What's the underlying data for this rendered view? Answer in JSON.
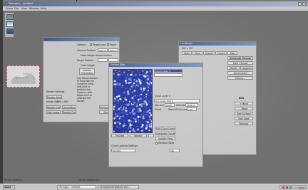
{
  "app": {
    "title": "Terragen – untitled"
  },
  "menu": [
    "Scene",
    "File",
    "View",
    "Window",
    "Help"
  ],
  "camera_panel": {
    "camera_label": "Camera",
    "target_lock": "Target Lock",
    "move": "Move",
    "camera_position": "Camera Position",
    "camera_position_values": [
      "500 m",
      "200 m"
    ],
    "fixed_height": "Fixed Height Above Surface",
    "target_position": "Target Position",
    "fixed_height_short": "Fixed Height",
    "camera_orientation": "Camera Orientation",
    "hint": "Use Mouse Button to describe the camera's view.",
    "hint2": "Left-click to position the Camera, with Right-click to indicate the Target.",
    "render_settings": "Render Settings",
    "image_size": "Image Size",
    "image_size_value": "800 x 600",
    "render_image": "Render Image",
    "render_preview": "Render Preview",
    "animation": "Animation",
    "exit_image": "Exit Image",
    "camera_settings": "Camera Settings",
    "more": "More..."
  },
  "landscape_window": {
    "title": "Landscape",
    "size": "257 x 257",
    "generate": "Generate Terrain",
    "view_sculpt": "View / Sculpt",
    "modify": "Modify",
    "combine": "Combine",
    "accumulate": "Accumulate",
    "effects": "Effects...",
    "open": "Open",
    "save": "Save",
    "import": "Import",
    "export": "Export",
    "size_btn": "Size",
    "edit_label": "Edit",
    "edit_buttons": [
      "+ Move",
      "- Move",
      "Add Surface",
      "Edit Edge",
      "Remove"
    ]
  },
  "surface_window": {
    "title": "Surface Map",
    "cloud_layer": "Cloud Layer 3",
    "sky_size": "Sky size",
    "sky_size_value": "2048",
    "altitude": "Altitude",
    "altitude_value": "1000 m",
    "depth": "Depth/Thickness",
    "fields": [
      "0.0 m  Rel. M.P. 2",
      "100",
      "20"
    ],
    "detail": "Detail",
    "buttons_right": [
      "Edit Cloud Layer...",
      "Generate Clouds...",
      "Update View"
    ],
    "random_seed": "Random Seed",
    "cloud_settings": "Cloud Lighting Settings",
    "density": "Density",
    "preview_opts": [
      "Preview",
      "Render",
      "Accept"
    ]
  },
  "taskbar": {
    "start": "Start",
    "items": [
      "Terragen - untitled",
      "Ohnepalette Notizen ber..."
    ],
    "clock": "12:00"
  },
  "status": {
    "left": "Terrain Loading...",
    "mid": "Terrain Setting 0/0"
  }
}
